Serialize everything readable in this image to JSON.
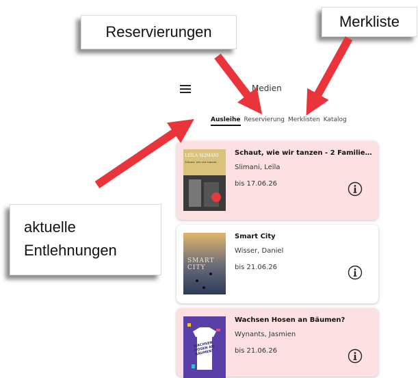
{
  "callouts": {
    "reservierungen": "Reservierungen",
    "merkliste": "Merkliste",
    "aktuelle_line1": "aktuelle",
    "aktuelle_line2": "Entlehnungen"
  },
  "colors": {
    "arrow": "#e8343a",
    "card_pink": "#fde1e2"
  },
  "header": {
    "menu_icon": "hamburger-icon",
    "title": "Medien"
  },
  "tabs": [
    {
      "label": "Ausleihe",
      "active": true
    },
    {
      "label": "Reservierung",
      "active": false
    },
    {
      "label": "Merklisten",
      "active": false
    },
    {
      "label": "Katalog",
      "active": false
    }
  ],
  "loans": [
    {
      "title": "Schaut, wie wir tanzen - 2 Familient...",
      "author": "Slimani, Leïla",
      "due": "bis 17.06.26",
      "cover_text": "LEÏLA SLIMANI",
      "cover_subtitle": "Schaut, wie wir tanzen",
      "info_icon": "info-icon"
    },
    {
      "title": "Smart City",
      "author": "Wisser, Daniel",
      "due": "bis 21.06.26",
      "cover_text": "SMART CITY",
      "info_icon": "info-icon"
    },
    {
      "title": "Wachsen Hosen an Bäumen?",
      "author": "Wynants, Jasmien",
      "due": "bis 21.06.26",
      "cover_text": "WACHSEN HOSEN AN BÄUMEN?",
      "info_icon": "info-icon"
    }
  ]
}
